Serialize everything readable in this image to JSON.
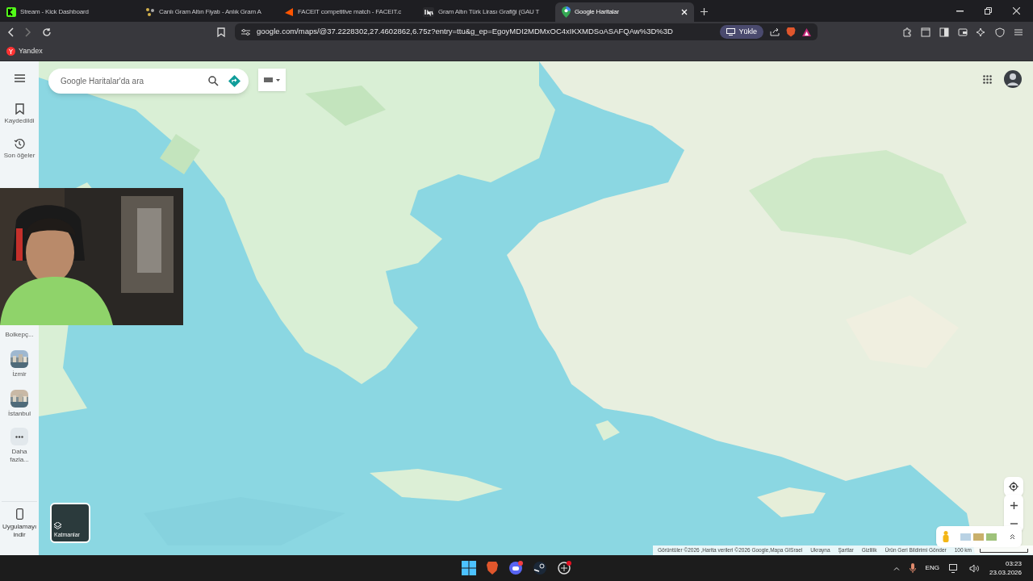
{
  "browser": {
    "tabs": [
      {
        "title": "Stream - Kick Dashboard",
        "selected": false
      },
      {
        "title": "Canlı Gram Altın Fiyatı - Anlık Gram A",
        "selected": false
      },
      {
        "title": "FACEIT competitive match - FACEIT.c",
        "selected": false
      },
      {
        "title": "Gram Altın Türk Lirası Grafiği (GAU T",
        "selected": false
      },
      {
        "title": "Google Haritalar",
        "selected": true
      }
    ],
    "address": "google.com/maps/@37.2228302,27.4602862,6.75z?entry=ttu&g_ep=EgoyMDI2MDMxOC4xIKXMDSoASAFQAw%3D%3D",
    "install_button": "Yükle",
    "bookmarks": [
      {
        "label": "Yandex"
      }
    ]
  },
  "maps": {
    "search": {
      "placeholder": "Google Haritalar'da ara"
    },
    "sidebar": [
      {
        "label": "Kaydedildi",
        "kind": "saved"
      },
      {
        "label": "Son öğeler",
        "kind": "recent"
      },
      {
        "label": "Bolkepç...",
        "kind": "hidden-place"
      },
      {
        "label": "İzmir",
        "kind": "place"
      },
      {
        "label": "İstanbul",
        "kind": "place"
      },
      {
        "label": "Daha fazla...",
        "kind": "more"
      }
    ],
    "download_app": "Uygulamayı indir",
    "layers_button": "Katmanlar",
    "attribution": [
      "Görüntüler ©2026 ,Harita verileri ©2026 Google,Mapa GISrael",
      "Ukrayna",
      "Şartlar",
      "Gizlilik",
      "Ürün Geri Bildirimi Gönder"
    ],
    "scale": "100 km"
  },
  "taskbar": {
    "language": "ENG",
    "time": "03:23",
    "date": "23.03.2026"
  }
}
